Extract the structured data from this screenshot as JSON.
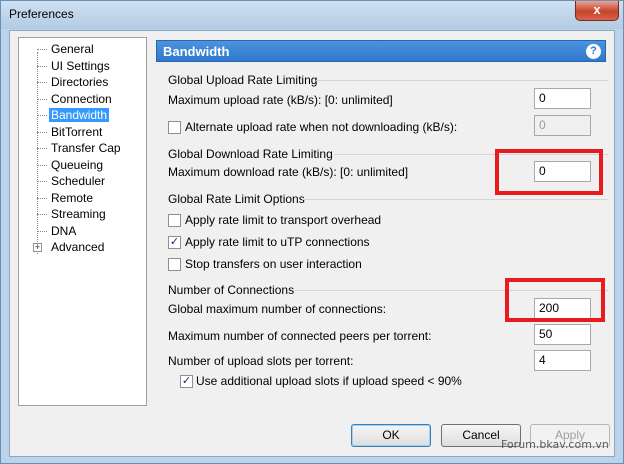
{
  "window": {
    "title": "Preferences",
    "close_label": "x"
  },
  "tree": {
    "items": [
      {
        "label": "General"
      },
      {
        "label": "UI Settings"
      },
      {
        "label": "Directories"
      },
      {
        "label": "Connection"
      },
      {
        "label": "Bandwidth",
        "selected": true
      },
      {
        "label": "BitTorrent"
      },
      {
        "label": "Transfer Cap"
      },
      {
        "label": "Queueing"
      },
      {
        "label": "Scheduler"
      },
      {
        "label": "Remote"
      },
      {
        "label": "Streaming"
      },
      {
        "label": "DNA"
      },
      {
        "label": "Advanced",
        "expander": "+"
      }
    ]
  },
  "panel": {
    "title": "Bandwidth",
    "help": "?",
    "upload_group": {
      "title": "Global Upload Rate Limiting",
      "max_upload_label": "Maximum upload rate (kB/s): [0: unlimited]",
      "max_upload_value": "0",
      "alternate_label": "Alternate upload rate when not downloading (kB/s):",
      "alternate_checked": false,
      "alternate_value": "0"
    },
    "download_group": {
      "title": "Global Download Rate Limiting",
      "max_download_label": "Maximum download rate (kB/s): [0: unlimited]",
      "max_download_value": "0"
    },
    "limit_options": {
      "title": "Global Rate Limit Options",
      "transport_label": "Apply rate limit to transport overhead",
      "transport_checked": false,
      "utp_label": "Apply rate limit to uTP connections",
      "utp_checked": true,
      "stop_label": "Stop transfers on user interaction",
      "stop_checked": false
    },
    "connections": {
      "title": "Number of Connections",
      "global_max_label": "Global maximum number of connections:",
      "global_max_value": "200",
      "peers_label": "Maximum number of connected peers per torrent:",
      "peers_value": "50",
      "slots_label": "Number of upload slots per torrent:",
      "slots_value": "4",
      "additional_label": "Use additional upload slots if upload speed < 90%",
      "additional_checked": true
    }
  },
  "buttons": {
    "ok": "OK",
    "cancel": "Cancel",
    "apply": "Apply"
  },
  "watermark": "Forum.bkav.com.vn",
  "colors": {
    "header": "#2f78cc",
    "highlight": "#e81c1c",
    "selection": "#3399ff"
  }
}
